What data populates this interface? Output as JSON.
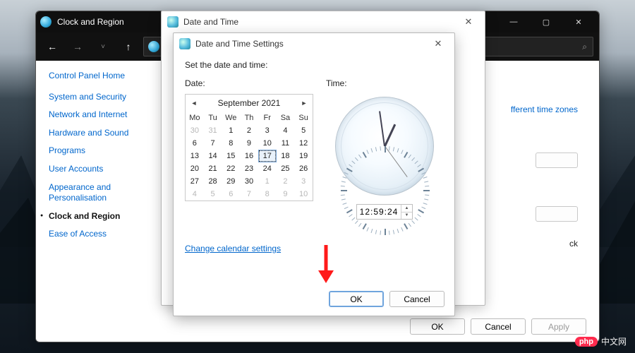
{
  "app": {
    "title": "Clock and Region",
    "window_buttons": {
      "min": "—",
      "max": "▢",
      "close": "✕"
    }
  },
  "sidebar": {
    "home": "Control Panel Home",
    "items": [
      "System and Security",
      "Network and Internet",
      "Hardware and Sound",
      "Programs",
      "User Accounts",
      "Appearance and Personalisation",
      "Clock and Region",
      "Ease of Access"
    ],
    "current_index": 6
  },
  "main": {
    "link_fragment": "fferent time zones",
    "clock_fragment": "ck",
    "bottom_buttons": {
      "ok": "OK",
      "cancel": "Cancel",
      "apply": "Apply"
    }
  },
  "dialog1": {
    "title": "Date and Time",
    "close": "✕"
  },
  "dialog2": {
    "title": "Date and Time Settings",
    "close": "✕",
    "heading": "Set the date and time:",
    "date_label": "Date:",
    "time_label": "Time:",
    "calendar": {
      "month_label": "September 2021",
      "prev": "◄",
      "next": "►",
      "day_headers": [
        "Mo",
        "Tu",
        "We",
        "Th",
        "Fr",
        "Sa",
        "Su"
      ],
      "rows": [
        [
          {
            "n": "30",
            "g": true
          },
          {
            "n": "31",
            "g": true
          },
          {
            "n": "1"
          },
          {
            "n": "2"
          },
          {
            "n": "3"
          },
          {
            "n": "4"
          },
          {
            "n": "5"
          }
        ],
        [
          {
            "n": "6"
          },
          {
            "n": "7"
          },
          {
            "n": "8"
          },
          {
            "n": "9"
          },
          {
            "n": "10"
          },
          {
            "n": "11"
          },
          {
            "n": "12"
          }
        ],
        [
          {
            "n": "13"
          },
          {
            "n": "14"
          },
          {
            "n": "15"
          },
          {
            "n": "16"
          },
          {
            "n": "17",
            "sel": true
          },
          {
            "n": "18"
          },
          {
            "n": "19"
          }
        ],
        [
          {
            "n": "20"
          },
          {
            "n": "21"
          },
          {
            "n": "22"
          },
          {
            "n": "23"
          },
          {
            "n": "24"
          },
          {
            "n": "25"
          },
          {
            "n": "26"
          }
        ],
        [
          {
            "n": "27"
          },
          {
            "n": "28"
          },
          {
            "n": "29"
          },
          {
            "n": "30"
          },
          {
            "n": "1",
            "g": true
          },
          {
            "n": "2",
            "g": true
          },
          {
            "n": "3",
            "g": true
          }
        ],
        [
          {
            "n": "4",
            "g": true
          },
          {
            "n": "5",
            "g": true
          },
          {
            "n": "6",
            "g": true
          },
          {
            "n": "7",
            "g": true
          },
          {
            "n": "8",
            "g": true
          },
          {
            "n": "9",
            "g": true
          },
          {
            "n": "10",
            "g": true
          }
        ]
      ]
    },
    "time_value": "12:59:24",
    "change_link": "Change calendar settings",
    "ok": "OK",
    "cancel": "Cancel"
  },
  "watermark": {
    "badge": "php",
    "text": "中文网"
  }
}
